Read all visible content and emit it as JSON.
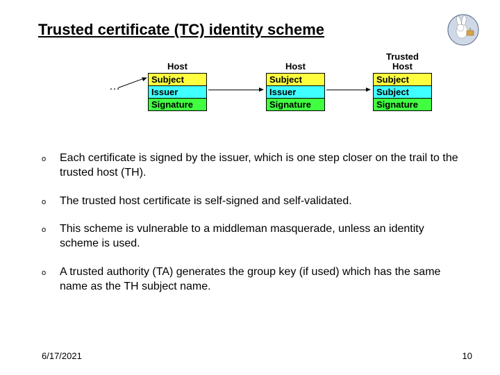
{
  "title": "Trusted certificate (TC) identity scheme",
  "diagram": {
    "ellipsis": "…",
    "cert1": {
      "caption": "Host",
      "subject": "Subject",
      "issuer": "Issuer",
      "signature": "Signature"
    },
    "cert2": {
      "caption": "Host",
      "subject": "Subject",
      "issuer": "Issuer",
      "signature": "Signature"
    },
    "cert3": {
      "caption_line1": "Trusted",
      "caption_line2": "Host",
      "subject": "Subject",
      "issuer": "Subject",
      "signature": "Signature"
    }
  },
  "bullets": [
    "Each certificate is signed by the issuer, which is one step closer on the trail to the trusted host (TH).",
    "The trusted host certificate is self-signed and self-validated.",
    "This scheme is vulnerable to a middleman masquerade, unless an identity scheme is used.",
    "A trusted authority (TA) generates the group key (if used) which has the same name as the TH subject name."
  ],
  "bullet_marker": "o",
  "footer": {
    "date": "6/17/2021",
    "page": "10"
  }
}
